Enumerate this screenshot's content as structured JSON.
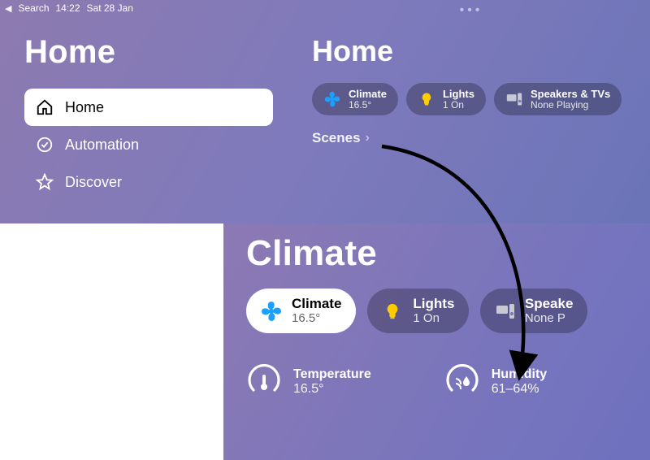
{
  "statusbar": {
    "back_label": "Search",
    "time": "14:22",
    "date": "Sat 28 Jan"
  },
  "sidebar": {
    "title": "Home",
    "items": [
      {
        "label": "Home",
        "icon": "home-icon",
        "selected": true
      },
      {
        "label": "Automation",
        "icon": "clock-check-icon",
        "selected": false
      },
      {
        "label": "Discover",
        "icon": "star-icon",
        "selected": false
      }
    ]
  },
  "main": {
    "title": "Home",
    "pills": [
      {
        "title": "Climate",
        "subtitle": "16.5°",
        "icon": "fan-icon",
        "icon_color": "#1aa0ff"
      },
      {
        "title": "Lights",
        "subtitle": "1 On",
        "icon": "bulb-icon",
        "icon_color": "#ffcc00"
      },
      {
        "title": "Speakers & TVs",
        "subtitle": "None Playing",
        "icon": "tv-speaker-icon",
        "icon_color": "#c9c9d6"
      }
    ],
    "section_label": "Scenes"
  },
  "detail": {
    "title": "Climate",
    "pills": [
      {
        "title": "Climate",
        "subtitle": "16.5°",
        "icon": "fan-icon",
        "icon_color": "#1aa0ff",
        "selected": true
      },
      {
        "title": "Lights",
        "subtitle": "1 On",
        "icon": "bulb-icon",
        "icon_color": "#ffcc00",
        "selected": false
      },
      {
        "title": "Speakers & TVs",
        "subtitle": "None Playing",
        "icon": "tv-speaker-icon",
        "icon_color": "#c9c9d6",
        "selected": false,
        "truncated_title": "Speake",
        "truncated_sub": "None P"
      }
    ],
    "stats": [
      {
        "label": "Temperature",
        "value": "16.5°",
        "icon": "thermometer-icon"
      },
      {
        "label": "Humidity",
        "value": "61–64%",
        "icon": "humidity-icon"
      }
    ]
  }
}
